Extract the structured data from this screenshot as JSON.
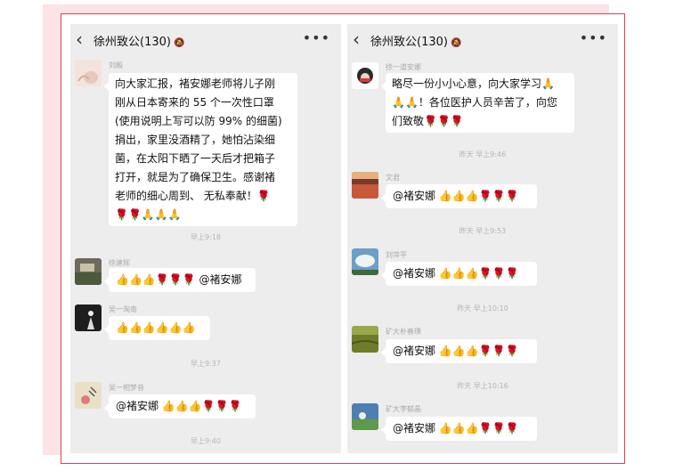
{
  "left": {
    "title": "徐州致公(130)",
    "messages": [
      {
        "sender": "刘殿",
        "lines": [
          "向大家汇报，褚安娜老师将儿子刚",
          "刚从日本寄来的 55 个一次性口罩",
          "(使用说明上写可以防 99% 的细菌)",
          "捐出，家里没酒精了，她怕沾染细",
          "菌，在太阳下晒了一天后才把箱子",
          "打开，就是为了确保卫生。感谢褚",
          "老师的细心周到、 无私奉献！🌹",
          "🌹🌹🙏🙏🙏"
        ]
      },
      {
        "time": "早上9:18"
      },
      {
        "sender": "徐建辉",
        "text": "👍👍👍🌹🌹🌹 @褚安娜"
      },
      {
        "sender": "吴一淘南",
        "text": "👍👍👍👍👍👍"
      },
      {
        "time": "早上9:37"
      },
      {
        "sender": "吴一相梦音",
        "text": "@褚安娜 👍👍👍🌹🌹🌹"
      },
      {
        "time": "早上9:40"
      }
    ]
  },
  "right": {
    "title": "徐州致公(130)",
    "messages": [
      {
        "sender": "徐一道安娜",
        "lines": [
          "略尽一份小小心意，向大家学习🙏",
          "🙏🙏！各位医护人员辛苦了，向您",
          "们致敬🌹🌹🌹"
        ]
      },
      {
        "time": "昨天 早上9:46"
      },
      {
        "sender": "文君",
        "text": "@褚安娜 👍👍👍🌹🌹🌹"
      },
      {
        "time": "昨天 早上9:53"
      },
      {
        "sender": "刘萍平",
        "text": "@褚安娜 👍👍👍🌹🌹🌹"
      },
      {
        "time": "昨天 早上10:10"
      },
      {
        "sender": "矿大朴春璞",
        "text": "@褚安娜 👍👍👍🌹🌹🌹"
      },
      {
        "time": "昨天 早上10:16"
      },
      {
        "sender": "矿大李郁晶",
        "text": "@褚安娜 👍👍👍🌹🌹🌹"
      }
    ]
  },
  "icons": {
    "back": "chevron-left-icon",
    "mute": "mute-bell-icon",
    "more": "more-dots-icon"
  },
  "colors": {
    "chat_bg": "#ededed",
    "bubble": "#ffffff",
    "frame": "#d9444f",
    "pink": "#fbe3e6"
  }
}
